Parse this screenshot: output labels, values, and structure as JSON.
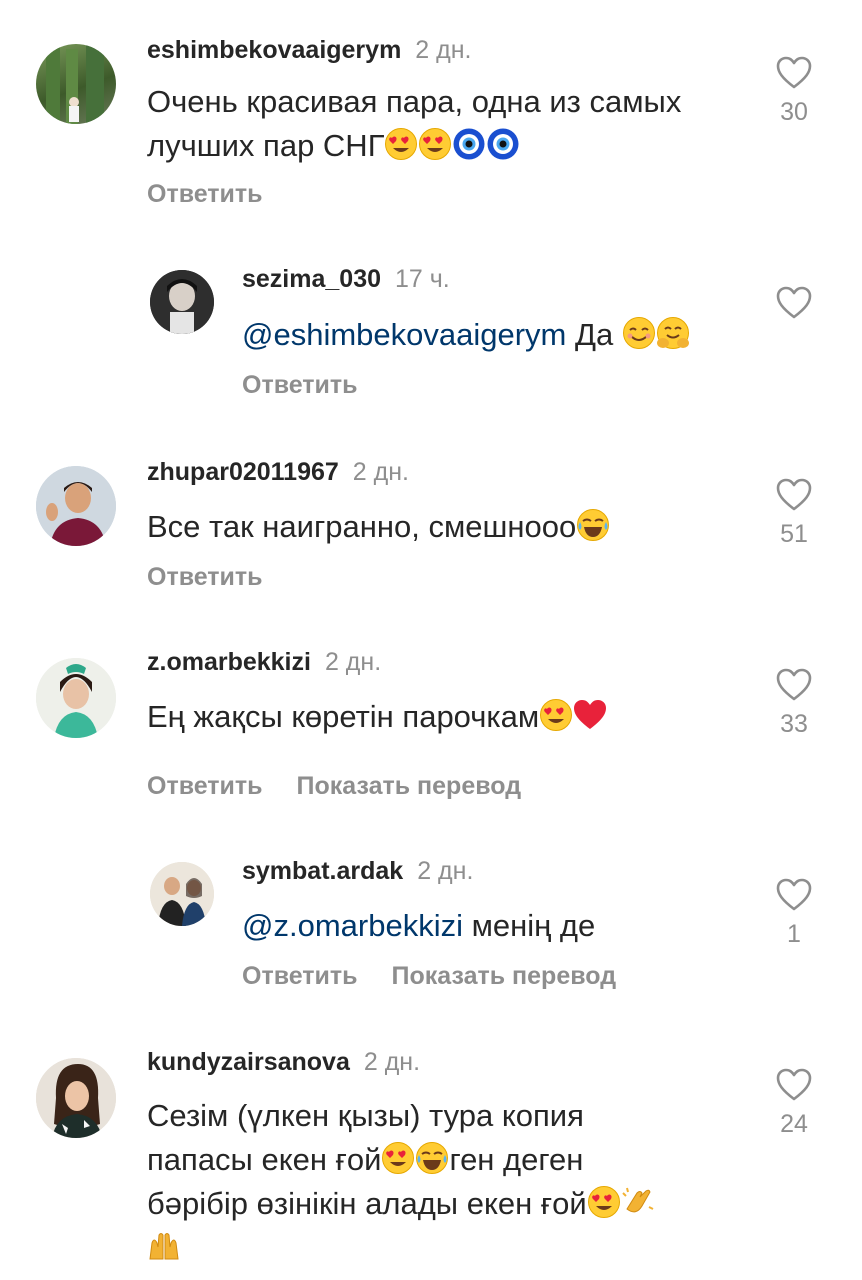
{
  "comments": [
    {
      "username": "eshimbekovaaigerym",
      "time": "2 дн.",
      "text_line1": "Очень красивая пара, одна из самых",
      "text_line2": "лучших пар СНГ",
      "reply_label": "Ответить",
      "likes": "30"
    },
    {
      "username": "sezima_030",
      "time": "17 ч.",
      "mention": "@eshimbekovaaigerym",
      "text": " Да ",
      "reply_label": "Ответить",
      "likes": ""
    },
    {
      "username": "zhupar02011967",
      "time": "2 дн.",
      "text": "Все так наигранно, смешнооо",
      "reply_label": "Ответить",
      "likes": "51"
    },
    {
      "username": "z.omarbekkizi",
      "time": "2 дн.",
      "text": "Ең жақсы көретін парочкам",
      "reply_label": "Ответить",
      "translate_label": "Показать перевод",
      "likes": "33"
    },
    {
      "username": "symbat.ardak",
      "time": "2 дн.",
      "mention": "@z.omarbekkizi",
      "text": " менің де",
      "reply_label": "Ответить",
      "translate_label": "Показать перевод",
      "likes": "1"
    },
    {
      "username": "kundyzairsanova",
      "time": "2 дн.",
      "text_line1": "Сезім (үлкен қызы) тура копия",
      "text_line2": "папасы екен ғой",
      "text_line2b": "ген деген",
      "text_line3": "бәрібір өзінікін алады екен ғой",
      "likes": "24"
    }
  ],
  "colors": {
    "username": "#262626",
    "secondary": "#8e8e8e",
    "mention": "#00376b"
  },
  "icons": [
    "heart-outline-icon",
    "heart-eyes-emoji",
    "nazar-amulet-emoji",
    "smiling-emoji",
    "hugging-emoji",
    "tears-of-joy-emoji",
    "red-heart-emoji",
    "clapping-hands-emoji",
    "raising-hands-emoji"
  ]
}
